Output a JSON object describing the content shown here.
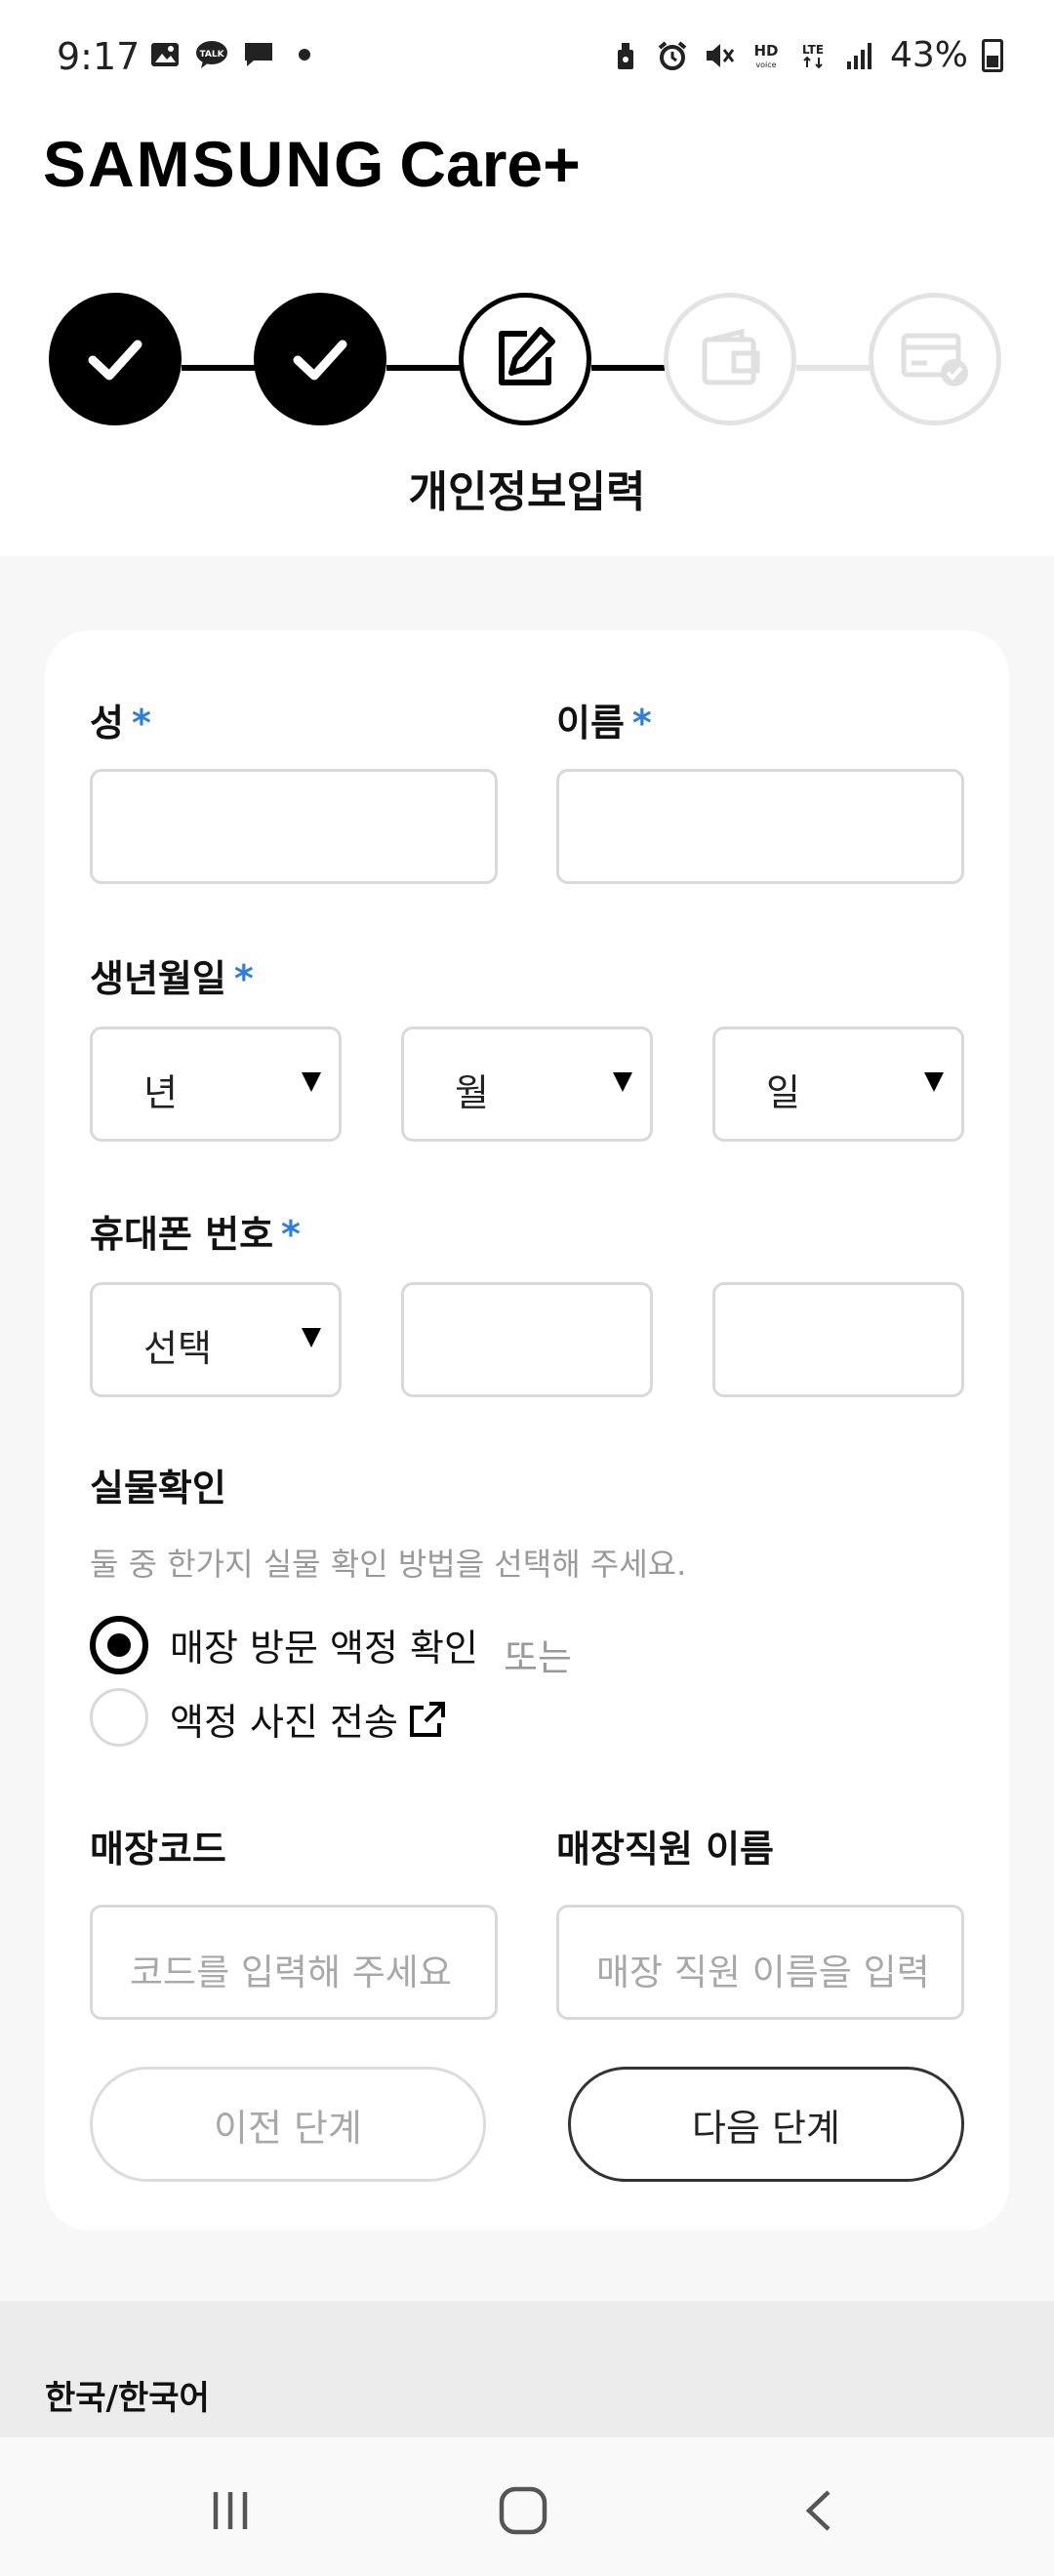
{
  "status_bar": {
    "time": "9:17",
    "battery": "43%",
    "icons_left": [
      "image-icon",
      "talk-icon",
      "message-icon",
      "dot-icon"
    ],
    "icons_right": [
      "lock-icon",
      "alarm-icon",
      "mute-icon",
      "hd-voice-icon",
      "lte-icon",
      "signal-icon",
      "battery-icon"
    ]
  },
  "header": {
    "brand": "SAMSUNG",
    "product": "Care+"
  },
  "stepper": {
    "steps": [
      {
        "state": "done",
        "icon": "check-icon"
      },
      {
        "state": "done",
        "icon": "check-icon"
      },
      {
        "state": "current",
        "icon": "edit-icon"
      },
      {
        "state": "future",
        "icon": "wallet-icon"
      },
      {
        "state": "future",
        "icon": "card-check-icon"
      }
    ],
    "current_title": "개인정보입력"
  },
  "form": {
    "last_name_label": "성",
    "first_name_label": "이름",
    "required_mark": "*",
    "birth_label": "생년월일",
    "birth_year": "년",
    "birth_month": "월",
    "birth_day": "일",
    "phone_label": "휴대폰 번호",
    "phone_prefix": "선택",
    "verify_label": "실물확인",
    "verify_helper": "둘 중 한가지 실물 확인 방법을 선택해 주세요.",
    "verify_option_store": "매장 방문 액정 확인",
    "verify_or": "또는",
    "verify_option_photo": "액정 사진 전송",
    "store_code_label": "매장코드",
    "store_code_placeholder": "코드를 입력해 주세요",
    "staff_name_label": "매장직원 이름",
    "staff_name_placeholder": "매장 직원 이름을 입력",
    "prev_button": "이전 단계",
    "next_button": "다음 단계"
  },
  "footer": {
    "language": "한국/한국어"
  },
  "colors": {
    "required": "#2d7ee0",
    "step_done": "#000000",
    "step_future": "#e3e3e3"
  }
}
